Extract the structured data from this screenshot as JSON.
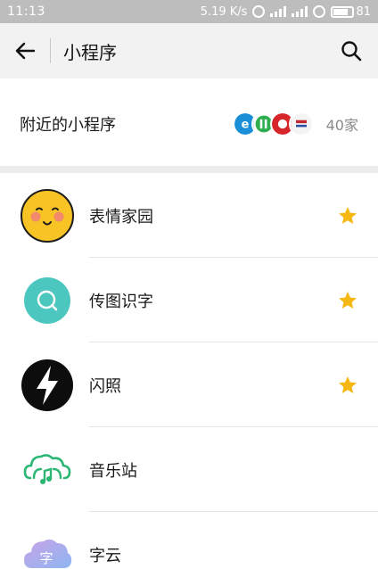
{
  "status_bar": {
    "time": "11:13",
    "net_speed": "5.19 K/s",
    "battery": "81"
  },
  "header": {
    "title": "小程序"
  },
  "nearby": {
    "label": "附近的小程序",
    "count": "40家"
  },
  "items": [
    {
      "label": "表情家园",
      "icon": "smiley-face-icon",
      "starred": true
    },
    {
      "label": "传图识字",
      "icon": "magnifier-circle-icon",
      "starred": true
    },
    {
      "label": "闪照",
      "icon": "lightning-icon",
      "starred": true
    },
    {
      "label": "音乐站",
      "icon": "cloud-note-icon",
      "starred": false
    },
    {
      "label": "字云",
      "icon": "cloud-text-icon",
      "starred": false
    }
  ],
  "colors": {
    "star": "#f5b712",
    "teal": "#4cc7bf",
    "green": "#2bb673",
    "yellow": "#f7c325"
  }
}
